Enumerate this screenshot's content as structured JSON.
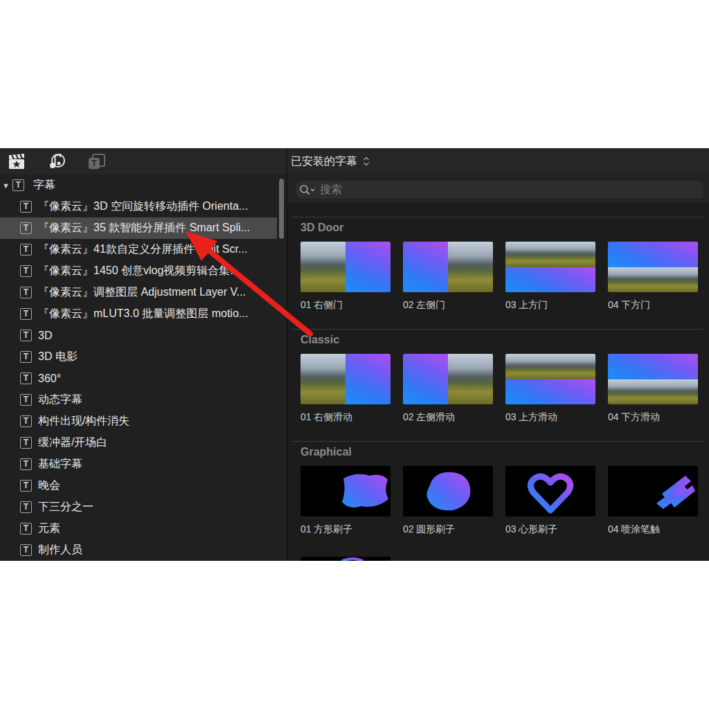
{
  "toolbar": {
    "icons": [
      {
        "dimmed": false
      },
      {
        "dimmed": false
      },
      {
        "glyph": "T",
        "dimmed": true
      }
    ]
  },
  "browser": {
    "title": "已安装的字幕"
  },
  "search": {
    "placeholder": "搜索"
  },
  "sidebar": {
    "item_icon": "T",
    "header": {
      "toggle": "▼",
      "label": "字幕",
      "expanded": true
    },
    "items": [
      {
        "label": "『像素云』3D 空间旋转移动插件 Orienta...",
        "selected": false
      },
      {
        "label": "『像素云』35 款智能分屏插件 Smart Spli...",
        "selected": true
      },
      {
        "label": "『像素云』41款自定义分屏插件 Split Scr...",
        "selected": false
      },
      {
        "label": "『像素云』1450 创意vlog视频剪辑合集...",
        "selected": false
      },
      {
        "label": "『像素云』调整图层 Adjustment Layer V...",
        "selected": false
      },
      {
        "label": "『像素云』mLUT3.0 批量调整图层 motio...",
        "selected": false
      },
      {
        "label": "3D",
        "selected": false
      },
      {
        "label": "3D 电影",
        "selected": false
      },
      {
        "label": "360°",
        "selected": false
      },
      {
        "label": "动态字幕",
        "selected": false
      },
      {
        "label": "构件出现/构件消失",
        "selected": false
      },
      {
        "label": "缓冲器/开场白",
        "selected": false
      },
      {
        "label": "基础字幕",
        "selected": false
      },
      {
        "label": "晚会",
        "selected": false
      },
      {
        "label": "下三分之一",
        "selected": false
      },
      {
        "label": "元素",
        "selected": false
      },
      {
        "label": "制作人员",
        "selected": false
      }
    ]
  },
  "sections": [
    {
      "title": "3D Door",
      "items": [
        {
          "label": "01 右侧门",
          "kind": "right"
        },
        {
          "label": "02 左侧门",
          "kind": "left"
        },
        {
          "label": "03 上方门",
          "kind": "top"
        },
        {
          "label": "04 下方门",
          "kind": "bottom"
        }
      ]
    },
    {
      "title": "Classic",
      "items": [
        {
          "label": "01 右侧滑动",
          "kind": "right"
        },
        {
          "label": "02 左侧滑动",
          "kind": "left"
        },
        {
          "label": "03 上方滑动",
          "kind": "top"
        },
        {
          "label": "04 下方滑动",
          "kind": "bottom"
        }
      ]
    },
    {
      "title": "Graphical",
      "items": [
        {
          "label": "01 方形刷子",
          "kind": "square"
        },
        {
          "label": "02 圆形刷子",
          "kind": "round"
        },
        {
          "label": "03 心形刷子",
          "kind": "heart"
        },
        {
          "label": "04 喷涂笔触",
          "kind": "spray"
        },
        {
          "kind": "scribble"
        }
      ]
    }
  ]
}
